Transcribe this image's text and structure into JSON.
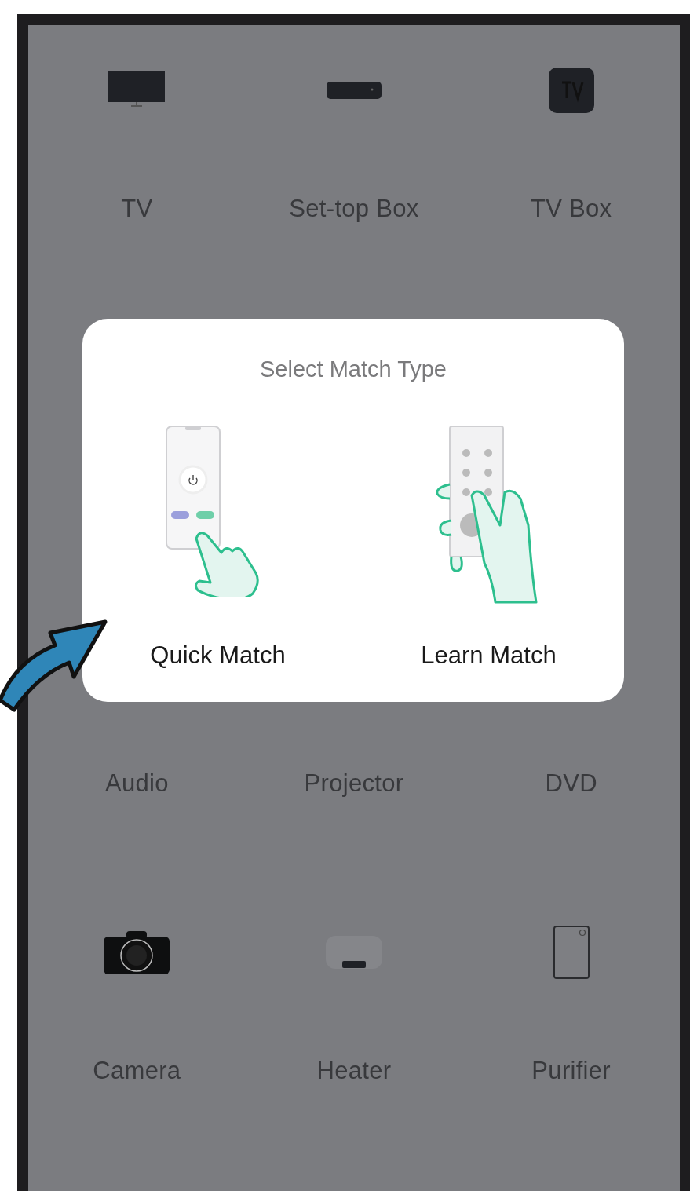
{
  "device_rows": [
    {
      "items": [
        {
          "label": "TV",
          "kind": "tv"
        },
        {
          "label": "Set-top Box",
          "kind": "set-top-box"
        },
        {
          "label": "TV Box",
          "kind": "tv-box"
        }
      ]
    },
    {
      "items": [
        {
          "label": "Audio"
        },
        {
          "label": "Projector"
        },
        {
          "label": "DVD"
        }
      ]
    },
    {
      "items": [
        {
          "label": "Camera",
          "kind": "camera"
        },
        {
          "label": "Heater",
          "kind": "heater"
        },
        {
          "label": "Purifier",
          "kind": "purifier"
        }
      ]
    }
  ],
  "dialog": {
    "title": "Select Match Type",
    "options": [
      {
        "label": "Quick Match",
        "kind": "quick"
      },
      {
        "label": "Learn Match",
        "kind": "learn"
      }
    ]
  }
}
